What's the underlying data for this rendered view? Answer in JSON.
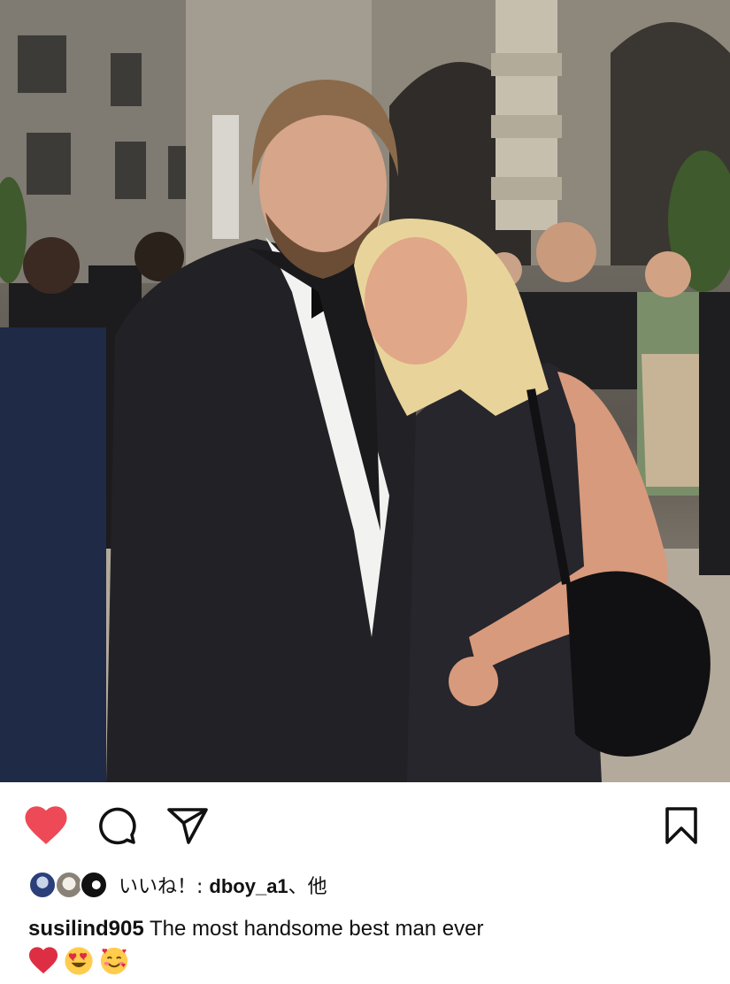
{
  "post": {
    "photo_alt": "",
    "actions": {
      "like_icon": "heart-filled-icon",
      "like_color": "#ed4956",
      "comment_icon": "comment-bubble-icon",
      "share_icon": "paper-plane-icon",
      "save_icon": "bookmark-icon"
    },
    "likes": {
      "prefix": "いいね！: ",
      "user": "dboy_a1",
      "suffix": "、他"
    },
    "caption": {
      "username": "susilind905",
      "text": " The most handsome best man ever"
    },
    "emojis": [
      "red-heart-emoji",
      "heart-eyes-emoji",
      "smiling-face-with-hearts-emoji"
    ]
  }
}
